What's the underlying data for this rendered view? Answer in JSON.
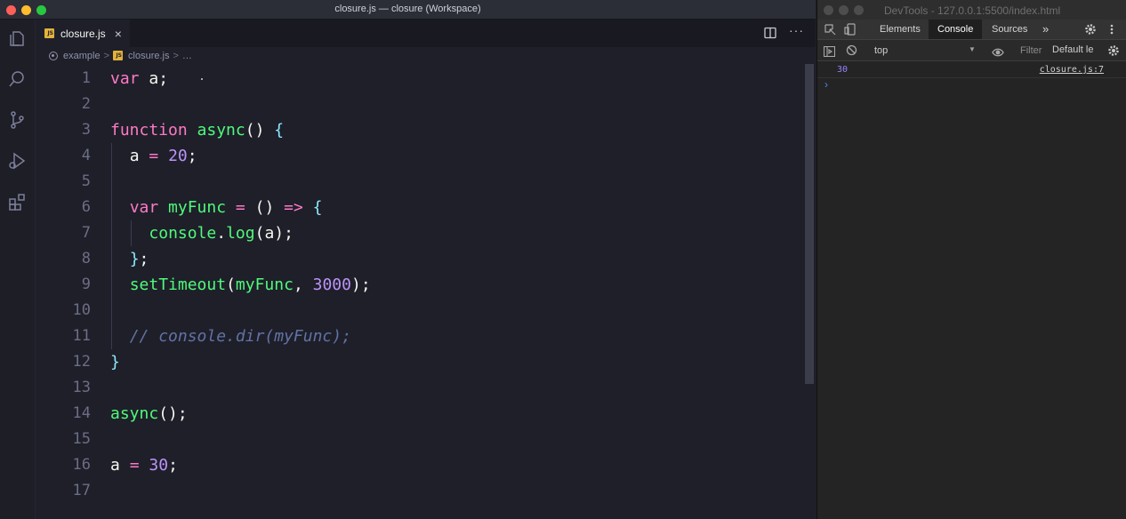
{
  "vscode": {
    "title": "closure.js — closure (Workspace)",
    "tab": {
      "label": "closure.js",
      "close": "×"
    },
    "more": "···",
    "breadcrumb": {
      "root": "example",
      "file": "closure.js",
      "rest": "…",
      "sep": ">"
    },
    "lines": [
      {
        "n": "1",
        "indent": 0,
        "tokens": [
          [
            "kw",
            "var"
          ],
          [
            "pl",
            " a;"
          ]
        ]
      },
      {
        "n": "2",
        "indent": 0,
        "tokens": []
      },
      {
        "n": "3",
        "indent": 0,
        "tokens": [
          [
            "kw",
            "function"
          ],
          [
            "pl",
            " "
          ],
          [
            "fn",
            "async"
          ],
          [
            "pl",
            "() "
          ],
          [
            "br",
            "{"
          ]
        ]
      },
      {
        "n": "4",
        "indent": 1,
        "tokens": [
          [
            "pl",
            "a "
          ],
          [
            "kw",
            "="
          ],
          [
            "pl",
            " "
          ],
          [
            "num",
            "20"
          ],
          [
            "pl",
            ";"
          ]
        ]
      },
      {
        "n": "5",
        "indent": 1,
        "tokens": []
      },
      {
        "n": "6",
        "indent": 1,
        "tokens": [
          [
            "kw",
            "var"
          ],
          [
            "pl",
            " "
          ],
          [
            "fn",
            "myFunc"
          ],
          [
            "pl",
            " "
          ],
          [
            "kw",
            "="
          ],
          [
            "pl",
            " () "
          ],
          [
            "kw",
            "=>"
          ],
          [
            "pl",
            " "
          ],
          [
            "br",
            "{"
          ]
        ]
      },
      {
        "n": "7",
        "indent": 2,
        "tokens": [
          [
            "fn",
            "console"
          ],
          [
            "pl",
            "."
          ],
          [
            "fn",
            "log"
          ],
          [
            "pl",
            "(a);"
          ]
        ]
      },
      {
        "n": "8",
        "indent": 1,
        "tokens": [
          [
            "br",
            "}"
          ],
          [
            "pl",
            ";"
          ]
        ]
      },
      {
        "n": "9",
        "indent": 1,
        "tokens": [
          [
            "fn",
            "setTimeout"
          ],
          [
            "pl",
            "("
          ],
          [
            "fn",
            "myFunc"
          ],
          [
            "pl",
            ", "
          ],
          [
            "num",
            "3000"
          ],
          [
            "pl",
            ");"
          ]
        ]
      },
      {
        "n": "10",
        "indent": 1,
        "tokens": []
      },
      {
        "n": "11",
        "indent": 1,
        "tokens": [
          [
            "cm",
            "// console.dir(myFunc);"
          ]
        ]
      },
      {
        "n": "12",
        "indent": 0,
        "tokens": [
          [
            "br",
            "}"
          ]
        ]
      },
      {
        "n": "13",
        "indent": 0,
        "tokens": []
      },
      {
        "n": "14",
        "indent": 0,
        "tokens": [
          [
            "fn",
            "async"
          ],
          [
            "pl",
            "();"
          ]
        ]
      },
      {
        "n": "15",
        "indent": 0,
        "tokens": []
      },
      {
        "n": "16",
        "indent": 0,
        "tokens": [
          [
            "pl",
            "a "
          ],
          [
            "kw",
            "="
          ],
          [
            "pl",
            " "
          ],
          [
            "num",
            "30"
          ],
          [
            "pl",
            ";"
          ]
        ]
      },
      {
        "n": "17",
        "indent": 0,
        "tokens": []
      }
    ],
    "colors": {
      "keyword": "#ff79c6",
      "function": "#50fa7b",
      "number": "#bd93f9",
      "comment": "#6272a4",
      "brace": "#8be9fd"
    },
    "activity_icons": [
      "files-icon",
      "search-icon",
      "source-control-icon",
      "run-debug-icon",
      "extensions-icon"
    ]
  },
  "devtools": {
    "title": "DevTools - 127.0.0.1:5500/index.html",
    "tabs": [
      "Elements",
      "Console",
      "Sources"
    ],
    "more_tabs": "»",
    "active_tab": "Console",
    "context": "top",
    "filter_placeholder": "Filter",
    "levels": "Default le",
    "log": {
      "value": "30",
      "source": "closure.js:7"
    },
    "prompt": "›"
  }
}
